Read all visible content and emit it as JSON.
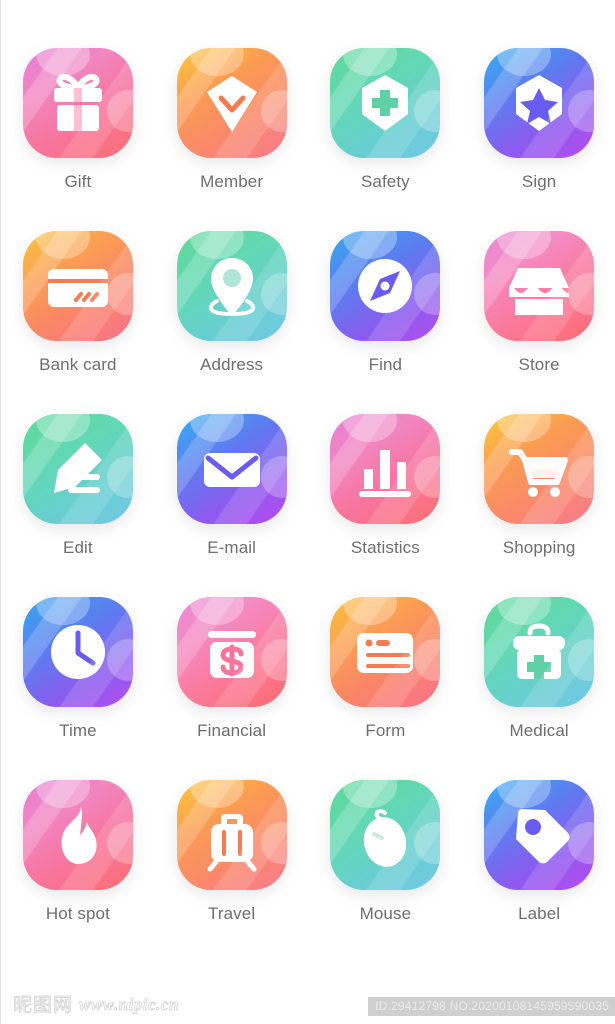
{
  "palette": {
    "pink": "#f8749c",
    "orange": "#fa8668",
    "green": "#62d8b3",
    "blue": "#8a5cee",
    "label_color": "#6d6d6d",
    "background": "#ffffff"
  },
  "grid": {
    "columns": 4,
    "rows": 5,
    "items": [
      {
        "label": "Gift",
        "icon": "gift-icon",
        "theme": "pink"
      },
      {
        "label": "Member",
        "icon": "diamond-icon",
        "theme": "orange"
      },
      {
        "label": "Safety",
        "icon": "shield-plus-icon",
        "theme": "green"
      },
      {
        "label": "Sign",
        "icon": "shield-star-icon",
        "theme": "blue"
      },
      {
        "label": "Bank card",
        "icon": "credit-card-icon",
        "theme": "orange"
      },
      {
        "label": "Address",
        "icon": "map-pin-icon",
        "theme": "green"
      },
      {
        "label": "Find",
        "icon": "compass-icon",
        "theme": "blue"
      },
      {
        "label": "Store",
        "icon": "storefront-icon",
        "theme": "pink"
      },
      {
        "label": "Edit",
        "icon": "pencil-icon",
        "theme": "green"
      },
      {
        "label": "E-mail",
        "icon": "envelope-icon",
        "theme": "blue"
      },
      {
        "label": "Statistics",
        "icon": "bar-chart-icon",
        "theme": "pink"
      },
      {
        "label": "Shopping",
        "icon": "shopping-cart-icon",
        "theme": "orange"
      },
      {
        "label": "Time",
        "icon": "clock-icon",
        "theme": "blue"
      },
      {
        "label": "Financial",
        "icon": "dollar-jar-icon",
        "theme": "pink"
      },
      {
        "label": "Form",
        "icon": "form-card-icon",
        "theme": "orange"
      },
      {
        "label": "Medical",
        "icon": "first-aid-kit-icon",
        "theme": "green"
      },
      {
        "label": "Hot spot",
        "icon": "flame-icon",
        "theme": "pink"
      },
      {
        "label": "Travel",
        "icon": "suitcase-icon",
        "theme": "orange"
      },
      {
        "label": "Mouse",
        "icon": "computer-mouse-icon",
        "theme": "green"
      },
      {
        "label": "Label",
        "icon": "price-tag-icon",
        "theme": "blue"
      }
    ]
  },
  "watermark": {
    "site_cn": "昵图网",
    "site_url": "www.nipic.cn",
    "id_text": "ID:29412798 NO:20200108145959590035"
  }
}
